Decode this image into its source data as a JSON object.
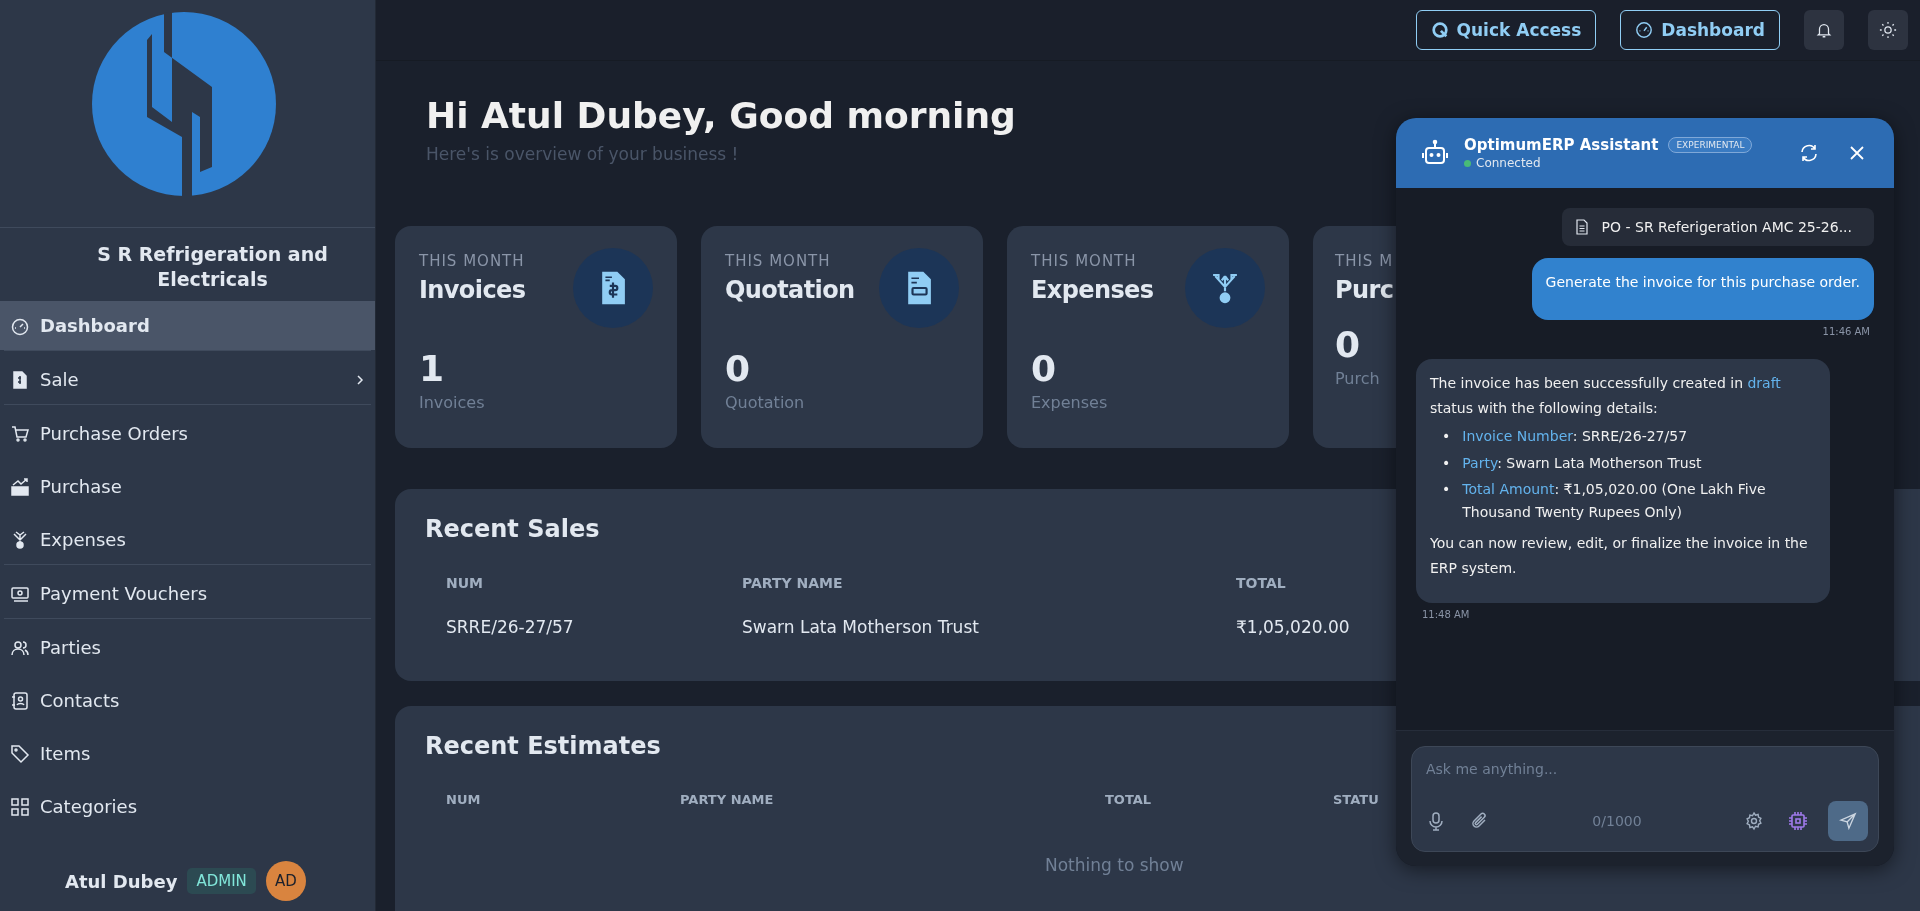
{
  "sidebar": {
    "company": "S R Refrigeration and Electricals",
    "items": [
      {
        "label": "Dashboard",
        "selected": true,
        "divider_after": true
      },
      {
        "label": "Sale",
        "selected": false,
        "divider_after": true,
        "expandable": true
      },
      {
        "label": "Purchase Orders",
        "selected": false
      },
      {
        "label": "Purchase",
        "selected": false
      },
      {
        "label": "Expenses",
        "selected": false,
        "divider_after": true
      },
      {
        "label": "Payment Vouchers",
        "selected": false,
        "divider_after": true
      },
      {
        "label": "Parties",
        "selected": false
      },
      {
        "label": "Contacts",
        "selected": false
      },
      {
        "label": "Items",
        "selected": false
      },
      {
        "label": "Categories",
        "selected": false
      }
    ],
    "user": {
      "name": "Atul Dubey",
      "role": "ADMIN",
      "initials": "AD"
    }
  },
  "header": {
    "buttons": [
      {
        "label": "Quick Access"
      },
      {
        "label": "Dashboard"
      }
    ]
  },
  "greeting": {
    "title": "Hi Atul Dubey, Good morning",
    "subtitle": "Here's is overview of your business !"
  },
  "stat_cards": [
    {
      "caption": "THIS MONTH",
      "title": "Invoices",
      "value": "1",
      "label": "Invoices"
    },
    {
      "caption": "THIS MONTH",
      "title": "Quotation",
      "value": "0",
      "label": "Quotation"
    },
    {
      "caption": "THIS MONTH",
      "title": "Expenses",
      "value": "0",
      "label": "Expenses"
    },
    {
      "caption": "THIS M",
      "title": "Purc",
      "value": "0",
      "label": "Purch"
    }
  ],
  "recent_sales": {
    "title": "Recent Sales",
    "columns": [
      "NUM",
      "PARTY NAME",
      "TOTAL"
    ],
    "rows": [
      [
        "SRRE/26-27/57",
        "Swarn Lata Motherson Trust",
        "₹1,05,020.00"
      ]
    ]
  },
  "recent_estimates": {
    "title": "Recent Estimates",
    "columns": [
      "NUM",
      "PARTY NAME",
      "TOTAL",
      "STATU"
    ],
    "empty_text": "Nothing to show"
  },
  "assistant": {
    "title": "OptimumERP Assistant",
    "badge": "EXPERIMENTAL",
    "status": "Connected",
    "connected": true,
    "attachment": "PO - SR Referigeration AMC 25-26...",
    "messages": [
      {
        "kind": "user",
        "text": "Generate the invoice for this purchase order.",
        "time": "11:46 AM"
      },
      {
        "kind": "assistant",
        "intro": "The invoice has been successfully created in **draft** status with the following details:",
        "bullets": [
          {
            "marker": "•",
            "text": "**Invoice Number**: SRRE/26-27/57"
          },
          {
            "marker": "•",
            "text": "**Party**: Swarn Lata Motherson Trust"
          },
          {
            "marker": "•",
            "text": "**Total Amount**: ₹1,05,020.00 (One Lakh Five Thousand Twenty Rupees Only)"
          }
        ],
        "closing": "You can now review, edit, or finalize the invoice in the ERP system.",
        "time": "11:48 AM"
      }
    ],
    "input": {
      "placeholder": "Ask me anything...",
      "counter": "0/1000"
    }
  }
}
